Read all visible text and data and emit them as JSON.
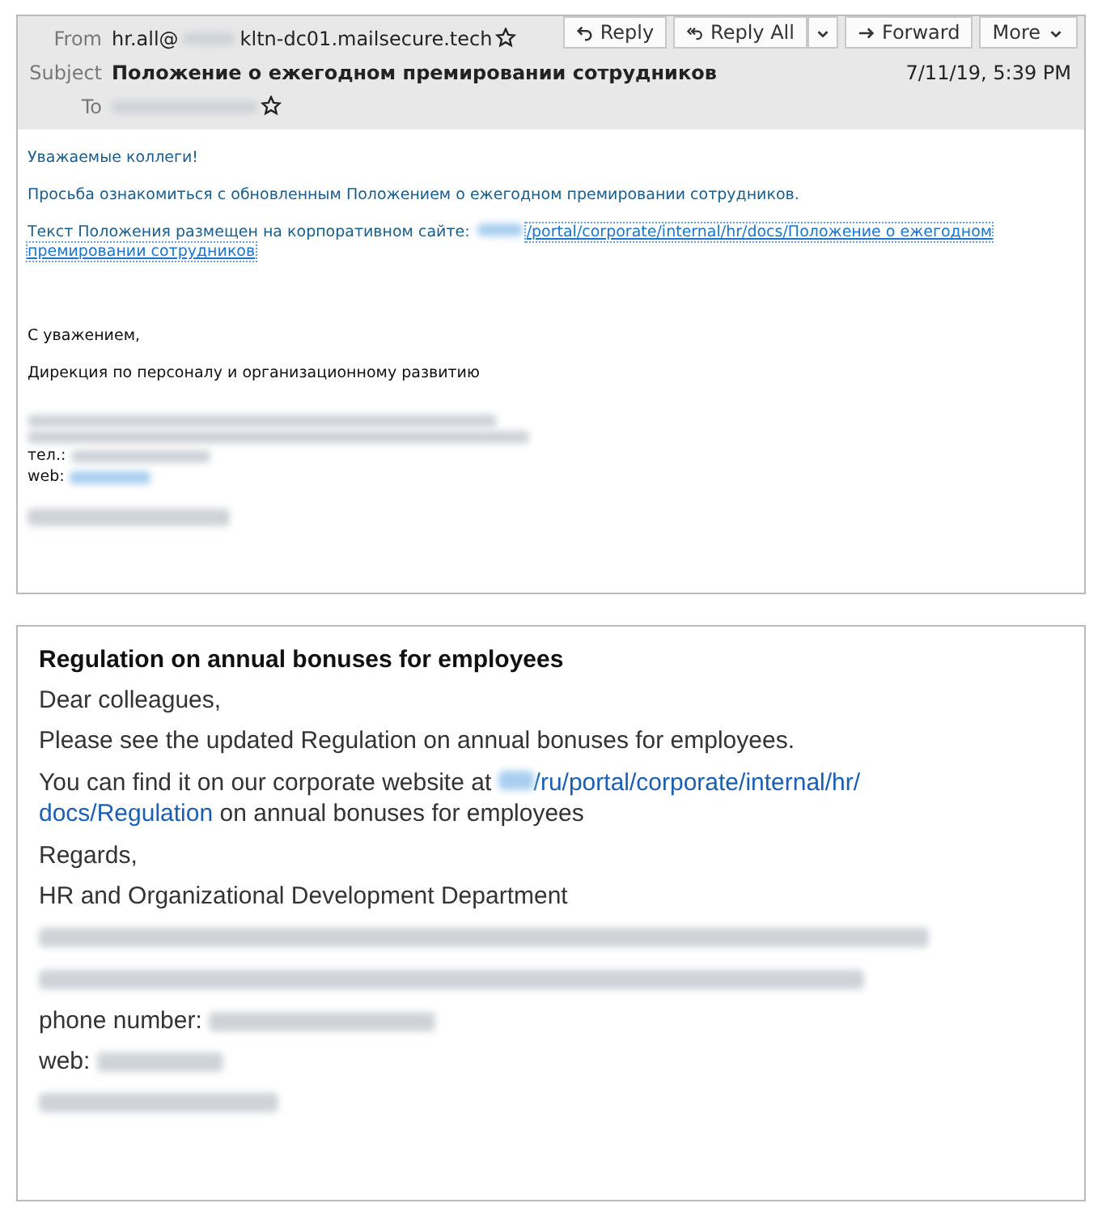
{
  "email": {
    "from_label": "From",
    "from_before": "hr.all@",
    "from_after": "kltn-dc01.mailsecure.tech",
    "subject_label": "Subject",
    "subject": "Положение о ежегодном премировании сотрудников",
    "to_label": "To",
    "date": "7/11/19, 5:39 PM",
    "buttons": [
      {
        "label": "Reply",
        "kind": "reply"
      },
      {
        "label": "Reply All",
        "kind": "reply-all"
      },
      {
        "label": "Forward",
        "kind": "forward"
      },
      {
        "label": "More",
        "kind": "more"
      }
    ],
    "greeting": "Уважаемые коллеги!",
    "request": "Просьба ознакомиться с обновленным Положением о ежегодном премировании сотрудников.",
    "link_intro": "Текст Положения размещен на корпоративном сайте: ",
    "link_parts": [
      "/portal/corporate/internal/hr/docs/Положение о ежегодном",
      "премировании сотрудников"
    ],
    "closing": "С уважением,",
    "department": "Дирекция по персоналу и организационному развитию",
    "phone_label": "тел.:",
    "web_label": "web:"
  },
  "translation": {
    "title": "Regulation on annual bonuses for employees",
    "greeting": "Dear colleagues,",
    "request": "Please see the updated Regulation on annual bonuses for employees.",
    "link_intro": "You can find it on our corporate website at ",
    "link_parts": [
      "/ru/portal/corporate/internal/hr/",
      "docs/Regulation"
    ],
    "link_outro": " on annual bonuses for employees",
    "closing": "Regards,",
    "department": "HR and Organizational Development Department",
    "phone_label": "phone number:",
    "web_label": "web:"
  }
}
